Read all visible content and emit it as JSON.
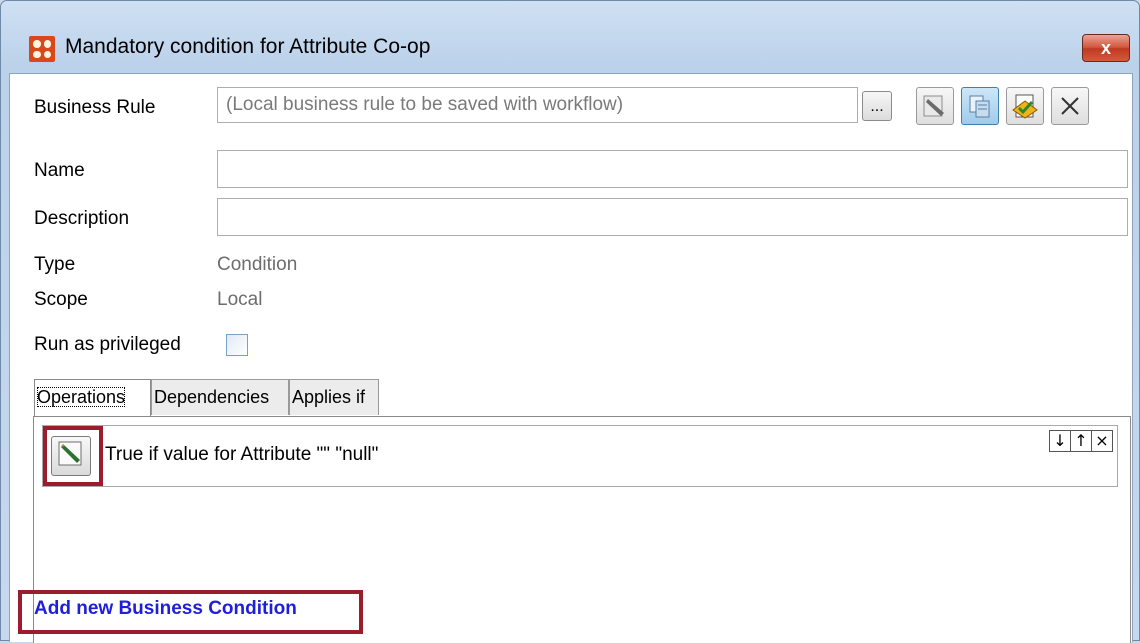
{
  "window": {
    "title": "Mandatory condition for Attribute Co-op",
    "close_glyph": "x"
  },
  "form": {
    "business_rule_label": "Business Rule",
    "business_rule_placeholder": "(Local business rule to be saved with workflow)",
    "browse_button_label": "...",
    "name_label": "Name",
    "name_value": "",
    "description_label": "Description",
    "description_value": "",
    "type_label": "Type",
    "type_value": "Condition",
    "scope_label": "Scope",
    "scope_value": "Local",
    "run_as_privileged_label": "Run as privileged",
    "run_as_privileged_checked": false
  },
  "toolbar": {
    "icons": [
      "edit-rule-icon",
      "copy-rule-icon",
      "approve-rule-icon",
      "delete-rule-icon"
    ]
  },
  "tabs": [
    {
      "label": "Operations",
      "active": true
    },
    {
      "label": "Dependencies",
      "active": false
    },
    {
      "label": "Applies if",
      "active": false
    }
  ],
  "operations": [
    {
      "text": "True if value for Attribute \"\"  \"null\""
    }
  ],
  "row_controls": {
    "down": "↓",
    "up": "↑",
    "remove": "×"
  },
  "add_condition_link": "Add new Business Condition",
  "colors": {
    "highlight_frame": "#9b1c2c",
    "link": "#1f1fd8",
    "window_chrome": "#c9d9ec"
  }
}
